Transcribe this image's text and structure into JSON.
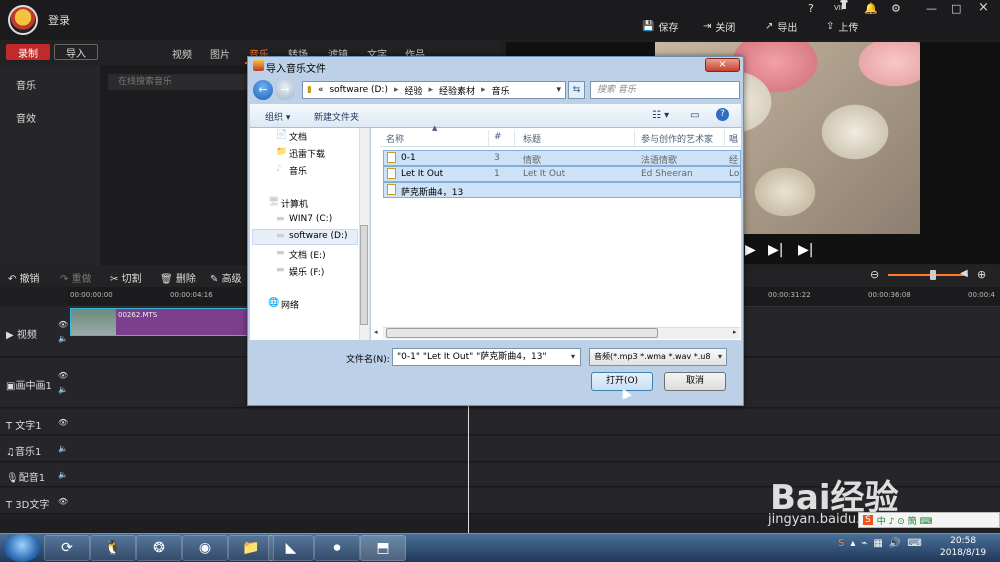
{
  "app": {
    "login": "登录",
    "top_icons": [
      "?",
      "VIP",
      "shirt-icon",
      "bell-icon",
      "gear-icon",
      "—",
      "□",
      "×"
    ],
    "save": "保存",
    "close": "关闭",
    "export": "导出",
    "upload": "上传",
    "record": "录制",
    "import": "导入",
    "categories": [
      "视频",
      "图片",
      "音乐",
      "转场",
      "滤镜",
      "文字",
      "作品"
    ],
    "active_category": "音乐",
    "left_panel": [
      "音乐",
      "音效"
    ],
    "music_search_placeholder": "在线搜索音乐",
    "edit_tools": [
      "撤销",
      "重做",
      "切割",
      "删除",
      "高级"
    ],
    "ruler_ticks_left": [
      "00:00:00:00",
      "00:00:04:16"
    ],
    "ruler_ticks_right": [
      "00:00:31:22",
      "00:00:36:08",
      "00:00:4"
    ],
    "tracks": [
      "视频",
      "画中画1",
      "文字1",
      "音乐1",
      "配音1",
      "3D文字"
    ],
    "clip_name": "00262.MTS"
  },
  "dialog": {
    "title": "导入音乐文件",
    "close": "×",
    "address": [
      "«",
      "software (D:)",
      "经验",
      "经验素材",
      "音乐"
    ],
    "search_placeholder": "搜索 音乐",
    "toolbar": {
      "organize": "组织 ▾",
      "new_folder": "新建文件夹"
    },
    "nav_items": [
      "文档",
      "迅雷下载",
      "音乐",
      "计算机",
      "WIN7 (C:)",
      "software (D:)",
      "文档 (E:)",
      "娱乐 (F:)",
      "网络"
    ],
    "columns": [
      "名称",
      "#",
      "标题",
      "参与创作的艺术家",
      "唱"
    ],
    "files": [
      {
        "name": "0-1",
        "num": "3",
        "title": "情歌",
        "artist": "法语情歌",
        "extra": "经"
      },
      {
        "name": "Let It Out",
        "num": "1",
        "title": "Let It Out",
        "artist": "Ed Sheeran",
        "extra": "Lo"
      },
      {
        "name": "萨克斯曲4，13",
        "num": "",
        "title": "",
        "artist": "",
        "extra": ""
      }
    ],
    "filename_label": "文件名(N):",
    "filename_value": "\"0-1\" \"Let It Out\" \"萨克斯曲4，13\"",
    "filetype": "音频(*.mp3 *.wma *.wav *.u8",
    "open": "打开(O)",
    "cancel": "取消"
  },
  "watermark": {
    "main": "Bai经验",
    "sub": "jingyan.baidu.com"
  },
  "ime": "中 ♪ ⊙ 簡 ⌨",
  "tray": {
    "time": "20:58",
    "date": "2018/8/19"
  }
}
